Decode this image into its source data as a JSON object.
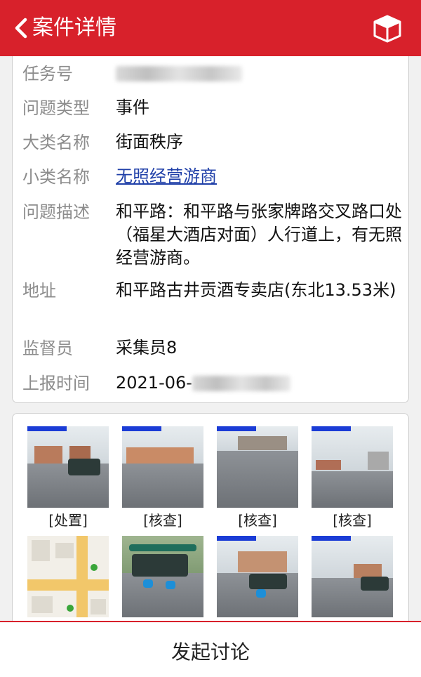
{
  "header": {
    "title": "案件详情",
    "back_icon": "chevron-left-icon",
    "action_icon": "cube-icon",
    "color": "#d8212b"
  },
  "details": [
    {
      "label": "任务号",
      "value": "",
      "redacted": true
    },
    {
      "label": "问题类型",
      "value": "事件"
    },
    {
      "label": "大类名称",
      "value": "街面秩序"
    },
    {
      "label": "小类名称",
      "value": "无照经营游商",
      "link": true
    },
    {
      "label": "问题描述",
      "value": "和平路：和平路与张家牌路交叉路口处（福星大酒店对面）人行道上，有无照经营游商。"
    },
    {
      "label": "地址",
      "value": "和平路古井贡酒专卖店(东北13.53米)"
    },
    {
      "label": "监督员",
      "value": "采集员8"
    },
    {
      "label": "上报时间",
      "value": "2021-06-",
      "redacted_suffix": true
    }
  ],
  "photos": [
    {
      "caption": "[处置]"
    },
    {
      "caption": "[核查]"
    },
    {
      "caption": "[核查]"
    },
    {
      "caption": "[核查]"
    },
    {
      "caption": ""
    },
    {
      "caption": ""
    },
    {
      "caption": ""
    },
    {
      "caption": ""
    }
  ],
  "footer": {
    "discuss_label": "发起讨论"
  },
  "link_color": "#1f3fa8"
}
